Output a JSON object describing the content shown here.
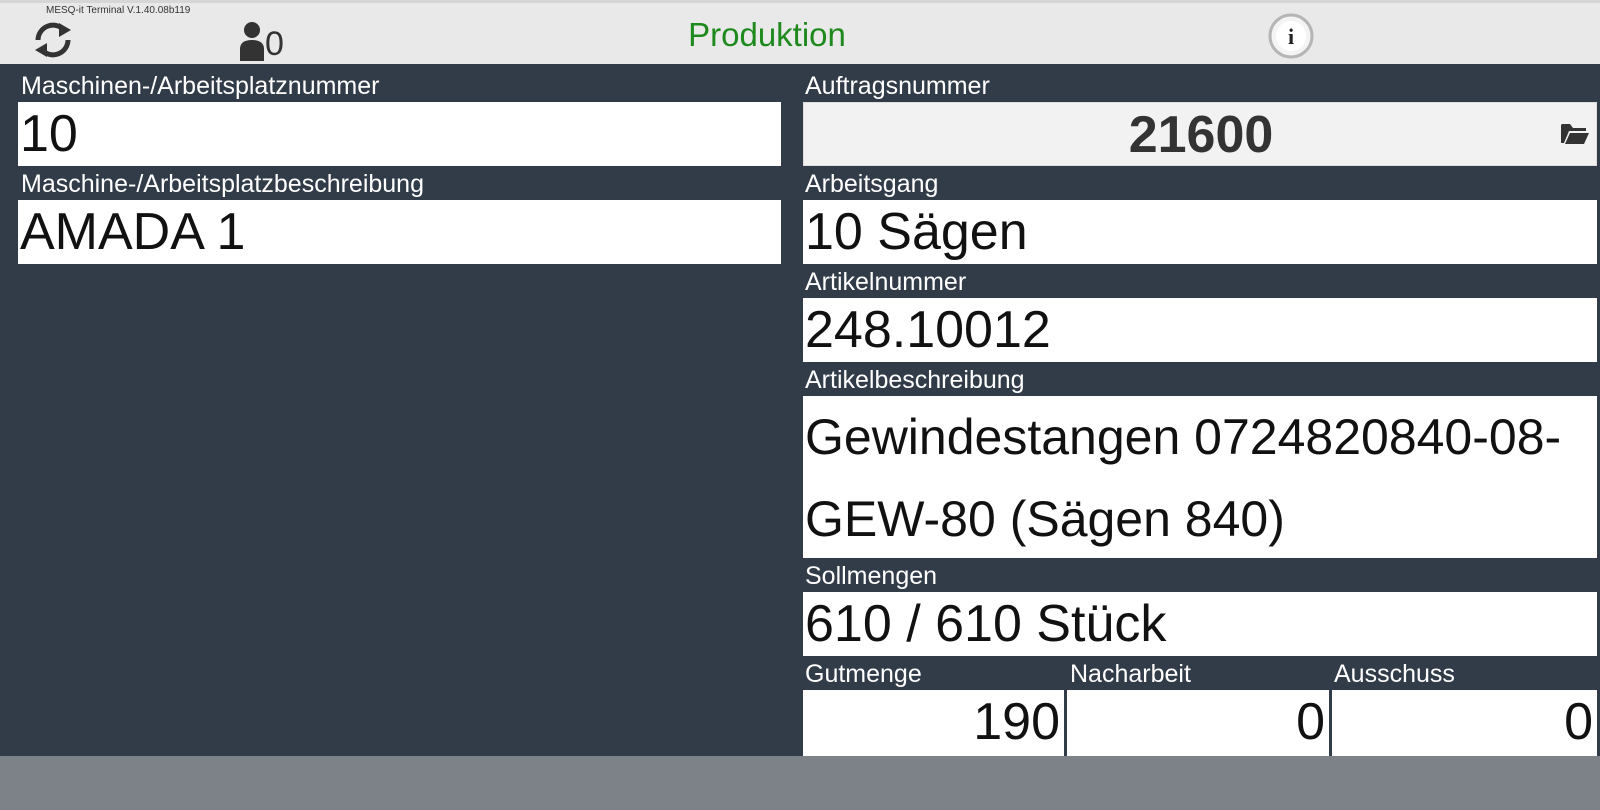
{
  "header": {
    "version": "MESQ-it Terminal V.1.40.08b119",
    "title": "Produktion",
    "user_count": "0"
  },
  "left": {
    "machine_number_label": "Maschinen-/Arbeitsplatznummer",
    "machine_number": "10",
    "machine_desc_label": "Maschine-/Arbeitsplatzbeschreibung",
    "machine_desc": "AMADA 1"
  },
  "right": {
    "order_label": "Auftragsnummer",
    "order_number": "21600",
    "operation_label": "Arbeitsgang",
    "operation": "10 Sägen",
    "article_number_label": "Artikelnummer",
    "article_number": "248.10012",
    "article_desc_label": "Artikelbeschreibung",
    "article_desc": "Gewindestangen 0724820840-08-GEW-80 (Sägen 840)",
    "target_label": "Sollmengen",
    "target_qty": "610 / 610 Stück"
  },
  "quantities": {
    "good_label": "Gutmenge",
    "good": "190",
    "rework_label": "Nacharbeit",
    "rework": "0",
    "scrap_label": "Ausschuss",
    "scrap": "0"
  },
  "colors": {
    "title": "#1e8a1e",
    "panel_bg": "#323c48",
    "header_bg": "#e9e9e9",
    "footer_bg": "#7d8288"
  },
  "icons": {
    "refresh": "refresh-icon",
    "users": "user-icon",
    "info": "info-icon",
    "folder": "folder-open-icon"
  }
}
